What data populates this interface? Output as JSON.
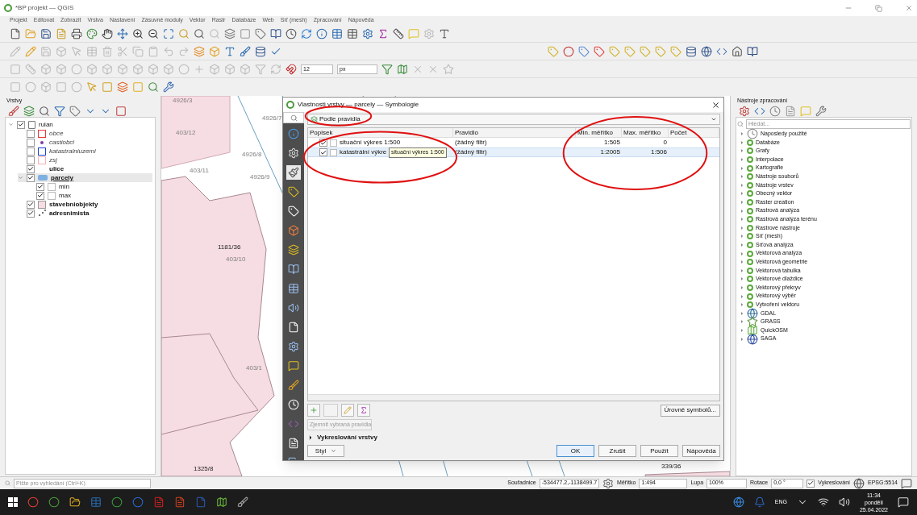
{
  "window": {
    "title": "*BP projekt — QGIS"
  },
  "menu": [
    "Projekt",
    "Editovat",
    "Zobrazit",
    "Vrstva",
    "Nastavení",
    "Zásuvné moduly",
    "Vektor",
    "Rastr",
    "Databáze",
    "Web",
    "Síť (mesh)",
    "Zpracování",
    "Nápověda"
  ],
  "snapping": {
    "value": "12",
    "unit": "px"
  },
  "layers_panel": {
    "title": "Vrstvy",
    "tree": [
      {
        "label": "ruian",
        "kind": "group",
        "checked": true,
        "expanded": true,
        "selected": false,
        "children": [
          {
            "label": "obce",
            "kind": "polygon",
            "checked": false,
            "color": "#e53935",
            "selected": false
          },
          {
            "label": "castiobci",
            "kind": "point",
            "checked": false,
            "color": "#7b3fa0",
            "selected": false
          },
          {
            "label": "katastralniuzemi",
            "kind": "polygon",
            "checked": false,
            "color": "#1e3fd0",
            "selected": false
          },
          {
            "label": "zsj",
            "kind": "polygon",
            "checked": false,
            "color": "#f4b0b8",
            "selected": false
          },
          {
            "label": "ulice",
            "kind": "line",
            "checked": true,
            "selected": false
          },
          {
            "label": "parcely",
            "kind": "group-layer",
            "checked": true,
            "expanded": true,
            "selected": true,
            "children": [
              {
                "label": "min",
                "kind": "rule",
                "checked": true,
                "selected": false
              },
              {
                "label": "max",
                "kind": "rule",
                "checked": true,
                "selected": false
              }
            ]
          },
          {
            "label": "stavebniobjekty",
            "kind": "fill",
            "checked": true,
            "color": "#f6dde3",
            "selected": false
          },
          {
            "label": "adresnimista",
            "kind": "dots",
            "checked": true,
            "selected": false
          }
        ]
      }
    ]
  },
  "map": {
    "labels": [
      "4926/3",
      "403/12",
      "4926/7",
      "4926/8",
      "403/11",
      "4926/9",
      "1181/36",
      "403/10",
      "403/1",
      "1325/8",
      "339/36"
    ]
  },
  "dialog": {
    "title": "Vlastnosti vrstvy — parcely — Symbologie",
    "renderer": "Podle pravidla",
    "columns": [
      "Popisek",
      "Pravidlo",
      "Min. měřítko",
      "Max. měřítko",
      "Počet"
    ],
    "rules": [
      {
        "label": "situační výkres 1:500",
        "checked": true,
        "rule": "(žádný filtr)",
        "min": "1:505",
        "max": "0",
        "selected": false
      },
      {
        "label": "katastrální výkre",
        "checked": true,
        "rule": "(žádný filtr)",
        "min": "1:2005",
        "max": "1:506",
        "selected": true
      }
    ],
    "tooltip": "situační výkres 1:500",
    "levels_button": "Úrovně symbolů...",
    "refine": "Zjemnit vybraná pravidla",
    "rendering_section": "Vykreslování vrstvy",
    "style_button": "Styl",
    "buttons": [
      "OK",
      "Zrušit",
      "Použít",
      "Nápověda"
    ]
  },
  "processing_panel": {
    "title": "Nástroje zpracování",
    "search_placeholder": "Hledat...",
    "items": [
      {
        "label": "Naposledy použité",
        "kind": "recent"
      },
      {
        "label": "Databáze",
        "kind": "qgis"
      },
      {
        "label": "Grafy",
        "kind": "qgis"
      },
      {
        "label": "Interpolace",
        "kind": "qgis"
      },
      {
        "label": "Kartografie",
        "kind": "qgis"
      },
      {
        "label": "Nástroje souborů",
        "kind": "qgis"
      },
      {
        "label": "Nástroje vrstev",
        "kind": "qgis"
      },
      {
        "label": "Obecný vektor",
        "kind": "qgis"
      },
      {
        "label": "Raster creation",
        "kind": "qgis"
      },
      {
        "label": "Rastrová analýza",
        "kind": "qgis"
      },
      {
        "label": "Rastrová analýza terénu",
        "kind": "qgis"
      },
      {
        "label": "Rastrové nástroje",
        "kind": "qgis"
      },
      {
        "label": "Síť (mesh)",
        "kind": "qgis"
      },
      {
        "label": "Síťová analýza",
        "kind": "qgis"
      },
      {
        "label": "Vektorová analýza",
        "kind": "qgis"
      },
      {
        "label": "Vektorová geometrie",
        "kind": "qgis"
      },
      {
        "label": "Vektorová tabulka",
        "kind": "qgis"
      },
      {
        "label": "Vektorové dlaždice",
        "kind": "qgis"
      },
      {
        "label": "Vektorový překryv",
        "kind": "qgis"
      },
      {
        "label": "Vektorový výběr",
        "kind": "qgis"
      },
      {
        "label": "Vytvoření vektoru",
        "kind": "qgis"
      },
      {
        "label": "GDAL",
        "kind": "gdal"
      },
      {
        "label": "GRASS",
        "kind": "grass"
      },
      {
        "label": "QuickOSM",
        "kind": "osm"
      },
      {
        "label": "SAGA",
        "kind": "saga"
      }
    ]
  },
  "status_bar": {
    "search_placeholder": "Pište pro vyhledání (Ctrl+K)",
    "coord_label": "Souřadnice",
    "coord": "-534477.2,-1138499.7",
    "scale_label": "Měřítko",
    "scale": "1:494",
    "zoom_label": "Lupa",
    "zoom": "100%",
    "rotation_label": "Rotace",
    "rotation": "0,0 °",
    "render_label": "Vykreslování",
    "render_checked": true,
    "crs": "EPSG:5514"
  },
  "taskbar": {
    "language": "ENG",
    "time": "11:34",
    "day": "pondělí",
    "date": "25.04.2022"
  }
}
